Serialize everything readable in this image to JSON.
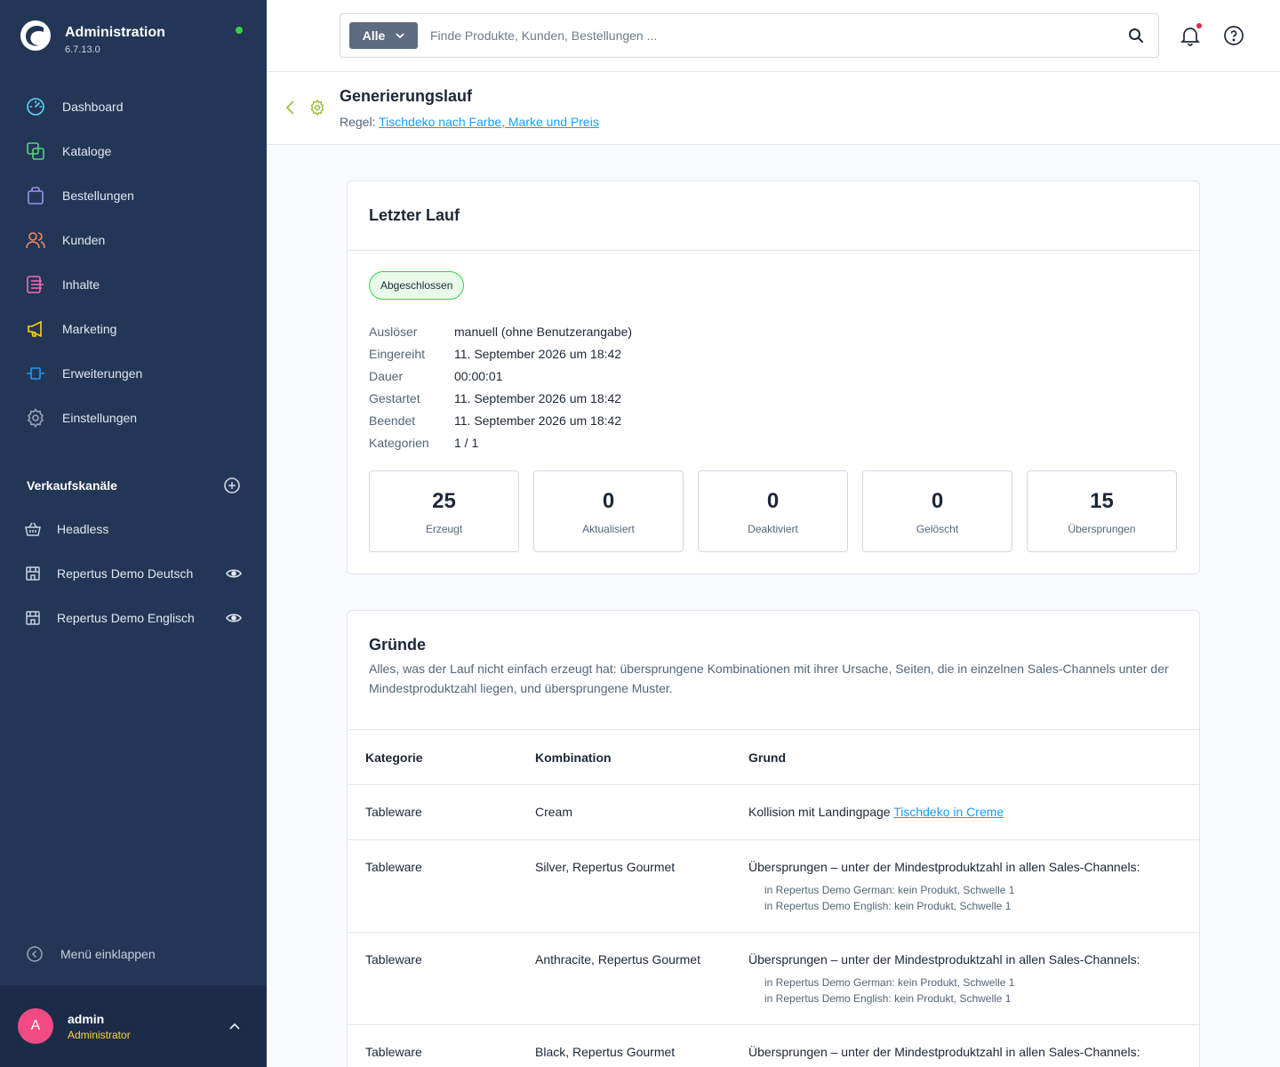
{
  "app": {
    "title": "Administration",
    "version": "6.7.13.0"
  },
  "nav": [
    {
      "label": "Dashboard",
      "icon": "dashboard-icon",
      "color": "#57d9fd"
    },
    {
      "label": "Kataloge",
      "icon": "catalog-icon",
      "color": "#57d287"
    },
    {
      "label": "Bestellungen",
      "icon": "orders-icon",
      "color": "#a092f0"
    },
    {
      "label": "Kunden",
      "icon": "customers-icon",
      "color": "#f88962"
    },
    {
      "label": "Inhalte",
      "icon": "content-icon",
      "color": "#ff68b4"
    },
    {
      "label": "Marketing",
      "icon": "marketing-icon",
      "color": "#ffd700"
    },
    {
      "label": "Erweiterungen",
      "icon": "extensions-icon",
      "color": "#189eff"
    },
    {
      "label": "Einstellungen",
      "icon": "settings-icon",
      "color": "#9aa8b5"
    }
  ],
  "sales_channels": {
    "title": "Verkaufskanäle",
    "items": [
      {
        "label": "Headless",
        "icon": "basket-icon"
      },
      {
        "label": "Repertus Demo Deutsch",
        "icon": "storefront-icon"
      },
      {
        "label": "Repertus Demo Englisch",
        "icon": "storefront-icon"
      }
    ]
  },
  "collapse_label": "Menü einklappen",
  "user": {
    "initial": "A",
    "name": "admin",
    "role": "Administrator"
  },
  "search": {
    "scope": "Alle",
    "placeholder": "Finde Produkte, Kunden, Bestellungen ..."
  },
  "page": {
    "title": "Generierungslauf",
    "rule_label": "Regel:",
    "rule_link": "Tischdeko nach Farbe, Marke und Preis"
  },
  "last_run": {
    "title": "Letzter Lauf",
    "status": "Abgeschlossen",
    "details": [
      {
        "key": "Auslöser",
        "value": "manuell (ohne Benutzerangabe)"
      },
      {
        "key": "Eingereiht",
        "value": "11. September 2026 um 18:42"
      },
      {
        "key": "Dauer",
        "value": "00:00:01"
      },
      {
        "key": "Gestartet",
        "value": "11. September 2026 um 18:42"
      },
      {
        "key": "Beendet",
        "value": "11. September 2026 um 18:42"
      },
      {
        "key": "Kategorien",
        "value": "1 / 1"
      }
    ],
    "stats": [
      {
        "value": "25",
        "label": "Erzeugt"
      },
      {
        "value": "0",
        "label": "Aktualisiert"
      },
      {
        "value": "0",
        "label": "Deaktiviert"
      },
      {
        "value": "0",
        "label": "Gelöscht"
      },
      {
        "value": "15",
        "label": "Übersprungen"
      }
    ]
  },
  "reasons": {
    "title": "Gründe",
    "description": "Alles, was der Lauf nicht einfach erzeugt hat: übersprungene Kombinationen mit ihrer Ursache, Seiten, die in einzelnen Sales-Channels unter der Mindestproduktzahl liegen, und übersprungene Muster.",
    "columns": [
      "Kategorie",
      "Kombination",
      "Grund"
    ],
    "rows": [
      {
        "category": "Tableware",
        "combination": "Cream",
        "reason": "Kollision mit Landingpage",
        "link": "Tischdeko in Creme",
        "details": []
      },
      {
        "category": "Tableware",
        "combination": "Silver, Repertus Gourmet",
        "reason": "Übersprungen – unter der Mindestproduktzahl in allen Sales-Channels:",
        "link": "",
        "details": [
          "in Repertus Demo German: kein Produkt, Schwelle 1",
          "in Repertus Demo English: kein Produkt, Schwelle 1"
        ]
      },
      {
        "category": "Tableware",
        "combination": "Anthracite, Repertus Gourmet",
        "reason": "Übersprungen – unter der Mindestproduktzahl in allen Sales-Channels:",
        "link": "",
        "details": [
          "in Repertus Demo German: kein Produkt, Schwelle 1",
          "in Repertus Demo English: kein Produkt, Schwelle 1"
        ]
      },
      {
        "category": "Tableware",
        "combination": "Black, Repertus Gourmet",
        "reason": "Übersprungen – unter der Mindestproduktzahl in allen Sales-Channels:",
        "link": "",
        "details": []
      }
    ]
  }
}
